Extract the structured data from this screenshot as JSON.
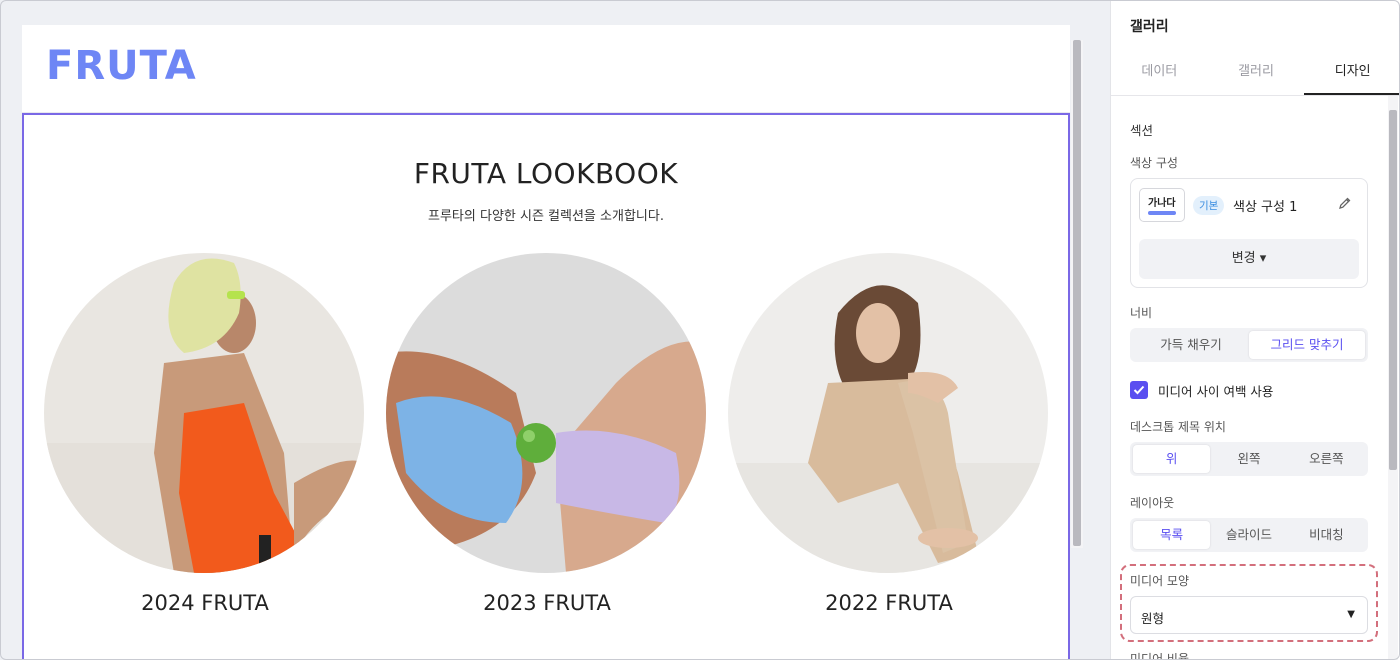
{
  "site": {
    "logo": "FRUTA",
    "title": "FRUTA LOOKBOOK",
    "subtitle": "프루타의 다양한 시즌 컬렉션을 소개합니다.",
    "items": [
      {
        "caption": "2024 FRUTA"
      },
      {
        "caption": "2023 FRUTA"
      },
      {
        "caption": "2022 FRUTA"
      }
    ]
  },
  "panel": {
    "title": "갤러리",
    "tabs": [
      "데이터",
      "갤러리",
      "디자인"
    ],
    "active_tab": "디자인",
    "section_label": "섹션",
    "color": {
      "label": "색상 구성",
      "swatch_text": "가나다",
      "badge": "기본",
      "scheme_name": "색상 구성 1",
      "change_button": "변경 ▾"
    },
    "width": {
      "label": "너비",
      "options": [
        "가득 채우기",
        "그리드 맞추기"
      ],
      "selected": "그리드 맞추기"
    },
    "media_gap": {
      "label": "미디어 사이 여백 사용",
      "checked": true
    },
    "desktop_title_position": {
      "label": "데스크톱 제목 위치",
      "options": [
        "위",
        "왼쪽",
        "오른쪽"
      ],
      "selected": "위"
    },
    "layout": {
      "label": "레이아웃",
      "options": [
        "목록",
        "슬라이드",
        "비대칭"
      ],
      "selected": "목록"
    },
    "media_shape": {
      "label": "미디어 모양",
      "value": "원형"
    },
    "media_ratio": {
      "label": "미디어 비율"
    }
  },
  "colors": {
    "accent": "#5a4ff0",
    "logo": "#6e86f5",
    "section_border": "#7a68e6",
    "highlight": "#d36f7c"
  }
}
